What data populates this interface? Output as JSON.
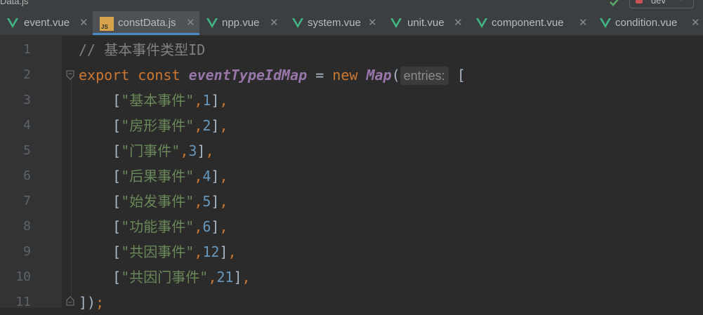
{
  "window": {
    "title": "Data.js",
    "branch": "dev"
  },
  "tabs": [
    {
      "label": "event.vue",
      "type": "vue",
      "active": false
    },
    {
      "label": "constData.js",
      "type": "js",
      "active": true
    },
    {
      "label": "npp.vue",
      "type": "vue",
      "active": false
    },
    {
      "label": "system.vue",
      "type": "vue",
      "active": false
    },
    {
      "label": "unit.vue",
      "type": "vue",
      "active": false
    },
    {
      "label": "component.vue",
      "type": "vue",
      "active": false
    },
    {
      "label": "condition.vue",
      "type": "vue",
      "active": false
    }
  ],
  "icons": {
    "vue": "vue-file-icon",
    "js": "js-file-icon",
    "close": "close-icon",
    "fold": "fold-icon"
  },
  "colors": {
    "keyword": "#cc7832",
    "string": "#6a8759",
    "number": "#6897bb",
    "comment": "#808080",
    "identifier": "#9876aa",
    "text": "#a9b7c6",
    "editor_bg": "#2b2b2b",
    "vue_green": "#41b883"
  },
  "code": {
    "line_numbers": [
      "1",
      "2",
      "3",
      "4",
      "5",
      "6",
      "7",
      "8",
      "9",
      "10",
      "11"
    ],
    "l1": {
      "comment": "// 基本事件类型ID"
    },
    "l2": {
      "kw_export": "export",
      "kw_const": "const",
      "name": "eventTypeIdMap",
      "eq": "=",
      "kw_new": "new",
      "cls": "Map",
      "open_paren": "(",
      "hint": "entries:",
      "open_bracket": "["
    },
    "entries": [
      {
        "str": "\"基本事件\"",
        "num": "1"
      },
      {
        "str": "\"房形事件\"",
        "num": "2"
      },
      {
        "str": "\"门事件\"",
        "num": "3"
      },
      {
        "str": "\"后果事件\"",
        "num": "4"
      },
      {
        "str": "\"始发事件\"",
        "num": "5"
      },
      {
        "str": "\"功能事件\"",
        "num": "6"
      },
      {
        "str": "\"共因事件\"",
        "num": "12"
      },
      {
        "str": "\"共因门事件\"",
        "num": "21"
      }
    ],
    "l11": {
      "close": "]);"
    }
  }
}
